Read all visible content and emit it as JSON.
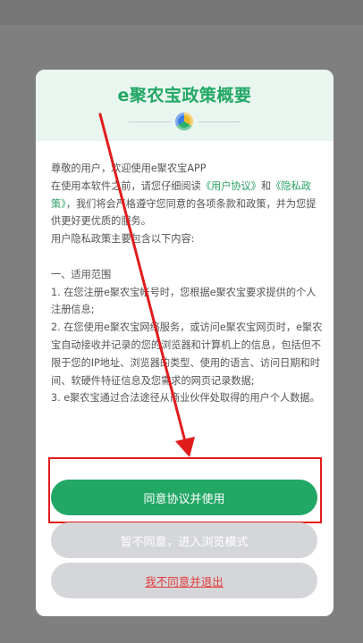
{
  "dialog": {
    "title": "e聚农宝政策概要",
    "greeting": "尊敬的用户，欢迎使用e聚农宝APP",
    "intro_prefix": "在使用本软件之前，请您仔细阅读",
    "user_agreement_link": "《用户协议》",
    "and": "和",
    "privacy_policy_link": "《隐私政策》",
    "intro_suffix": "，我们将会严格遵守您同意的各项条款和政策，并为您提供更好更优质的服务。",
    "summary_line": "用户隐私政策主要包含以下内容:",
    "section_title": "一、适用范围",
    "item1": "1. 在您注册e聚农宝帐号时，您根据e聚农宝要求提供的个人注册信息;",
    "item2": "2. 在您使用e聚农宝网络服务，或访问e聚农宝网页时，e聚农宝自动接收并记录的您的浏览器和计算机上的信息，包括但不限于您的IP地址、浏览器的类型、使用的语言、访问日期和时间、软硬件特征信息及您需求的网页记录数据;",
    "item3": "3. e聚农宝通过合法途径从商业伙伴处取得的用户个人数据。"
  },
  "buttons": {
    "agree": "同意协议并使用",
    "browse": "暂不同意，进入浏览模式",
    "exit": "我不同意并退出"
  },
  "colors": {
    "accent": "#22a765",
    "annotation": "#e11c1c",
    "link": "#2aa063",
    "disabled_button": "#d4d6d9",
    "exit_text": "#e23c3c"
  }
}
